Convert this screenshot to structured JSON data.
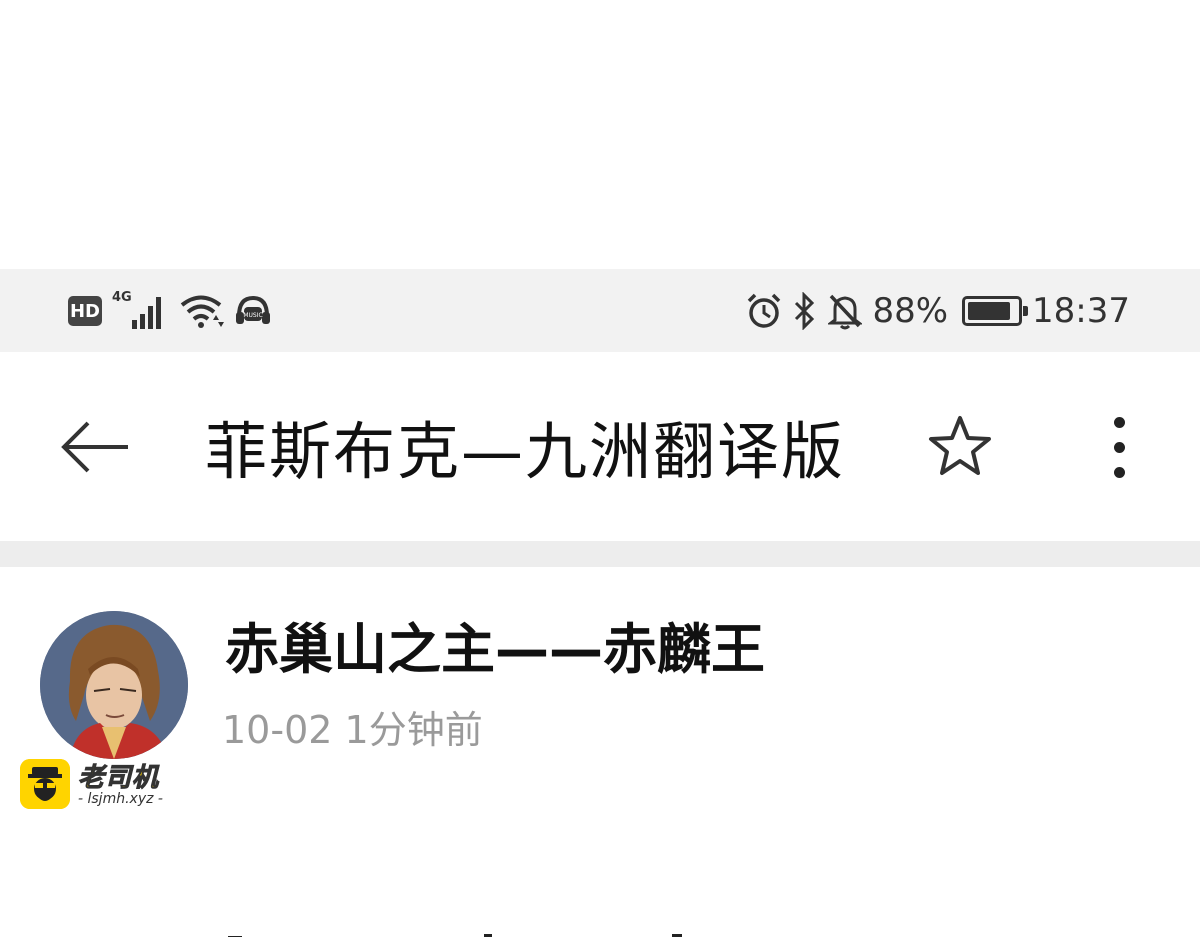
{
  "status_bar": {
    "hd_label": "HD",
    "network_label": "4G",
    "battery_percent": "88%",
    "battery_level": 0.88,
    "time": "18:37",
    "icons": [
      "hd-icon",
      "signal-icon",
      "wifi-icon",
      "music-headphone-icon",
      "alarm-icon",
      "bluetooth-icon",
      "mute-bell-icon",
      "battery-icon"
    ]
  },
  "app_bar": {
    "title": "菲斯布克—九洲翻译版",
    "icons": [
      "back-arrow-icon",
      "star-icon",
      "more-vert-icon"
    ]
  },
  "post": {
    "author": "赤巢山之主——赤麟王",
    "date": "10-02",
    "relative_time": "1分钟前"
  },
  "watermark": {
    "name": "老司机",
    "url": "- lsjmh.xyz -"
  },
  "colors": {
    "status_bar_bg": "#f2f2f2",
    "divider": "#ededed",
    "meta_text": "#9a9a9a",
    "watermark_yellow": "#ffd400"
  }
}
